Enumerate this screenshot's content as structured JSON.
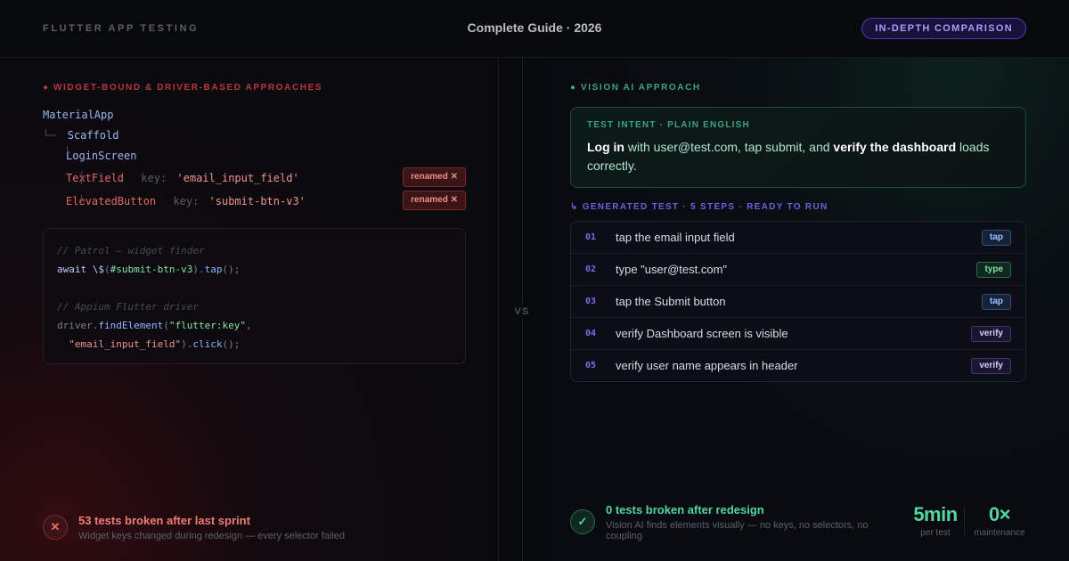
{
  "header": {
    "brand": "FLUTTER APP TESTING",
    "guide_title": "Complete Guide · 2026",
    "badge": "IN-DEPTH COMPARISON"
  },
  "left": {
    "section_title": "● WIDGET-BOUND & DRIVER-BASED APPROACHES",
    "tree": {
      "root": "MaterialApp",
      "branch_glyph": "└─",
      "scaffold": "Scaffold",
      "screen_glyph": "└",
      "screen": "LoginScreen",
      "textfield": {
        "glyph": "├",
        "widget": "TextField",
        "key_label": "key:",
        "key_value": "'email_input_field'",
        "badge": "renamed ✕"
      },
      "button": {
        "glyph": "└",
        "widget": "ElevatedButton",
        "key_label": "key:",
        "key_value": "'submit-btn-v3'",
        "badge": "renamed ✕"
      }
    },
    "code": {
      "comment_patrol": "// Patrol — widget finder",
      "patrol_await": "await",
      "patrol_dollar": "\\$",
      "patrol_paren_open": "(",
      "patrol_selector": "#submit-btn-v3",
      "patrol_paren_close": ").",
      "patrol_method": "tap",
      "patrol_end": "();",
      "comment_appium": "// Appium Flutter driver",
      "driver_obj": "driver.",
      "driver_method": "findElement",
      "driver_paren": "(",
      "driver_arg1": "\"flutter:key\"",
      "driver_comma": ",",
      "driver_arg2": "\"email_input_field\"",
      "driver_close": ").",
      "driver_click": "click",
      "driver_end": "();"
    },
    "status": {
      "icon": "✕",
      "title": "53 tests broken after last sprint",
      "subtitle": "Widget keys changed during redesign — every selector failed"
    }
  },
  "vs_label": "VS",
  "right": {
    "section_title": "● VISION AI APPROACH",
    "intent": {
      "label": "TEST INTENT · PLAIN ENGLISH",
      "bold1": "Log in",
      "text1": " with user@test.com, tap submit, and ",
      "bold2": "verify the dashboard",
      "text2": " loads correctly."
    },
    "generated_label": "↳ GENERATED TEST · 5 STEPS · READY TO RUN",
    "steps": [
      {
        "num": "01",
        "text": "tap the email input field",
        "tag": "tap"
      },
      {
        "num": "02",
        "text": "type \"user@test.com\"",
        "tag": "type"
      },
      {
        "num": "03",
        "text": "tap the Submit button",
        "tag": "tap"
      },
      {
        "num": "04",
        "text": "verify Dashboard screen is visible",
        "tag": "verify"
      },
      {
        "num": "05",
        "text": "verify user name appears in header",
        "tag": "verify"
      }
    ],
    "status": {
      "icon": "✓",
      "title": "0 tests broken after redesign",
      "subtitle": "Vision AI finds elements visually — no keys, no selectors, no coupling"
    },
    "metrics": [
      {
        "value": "5min",
        "label": "per test"
      },
      {
        "value": "0×",
        "label": "maintenance"
      }
    ]
  }
}
